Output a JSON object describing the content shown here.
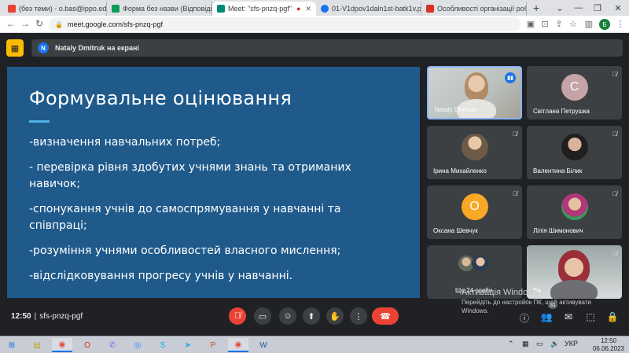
{
  "browser": {
    "tabs": [
      {
        "label": "(без теми) - o.bas@ippo.edu.",
        "icon": "gmail-icon",
        "color": "#ea4335"
      },
      {
        "label": "Форма без назви (Відповіді)",
        "icon": "sheets-icon",
        "color": "#0f9d58"
      },
      {
        "label": "Meet: \"sfs-pnzq-pgf\"",
        "icon": "meet-icon",
        "color": "#00897b",
        "active": true
      },
      {
        "label": "01-V1dpov1daln1st-batk1v.pd",
        "icon": "pdf-icon",
        "color": "#1a73e8"
      },
      {
        "label": "Особливості організації робо",
        "icon": "page-icon",
        "color": "#d93025"
      }
    ],
    "new_tab": "+",
    "url": "meet.google.com/sfs-pnzq-pgf",
    "profile_initial": "Б"
  },
  "meet": {
    "presenter_banner": "Nataly Dmitruk на екрані",
    "presenter_initial": "N",
    "slide": {
      "title": "Формувальне оцінювання",
      "bullets": [
        "-визначення навчальних потреб;",
        "- перевірка рівня здобутих учнями знань та отриманих навичок;",
        "-спонукання учнів до самоспрямування у навчанні та співпраці;",
        "-розуміння учнями особливостей власного мислення;",
        "-відслідковування прогресу учнів у навчанні."
      ]
    },
    "participants": [
      {
        "name": "Nataly Dmitruk",
        "speaking": true,
        "kind": "video"
      },
      {
        "name": "Світлана Петрушка",
        "initial": "С",
        "avatar_color": "#c5a3a6",
        "kind": "initial"
      },
      {
        "name": "Ірина Михайленко",
        "kind": "photo"
      },
      {
        "name": "Валентина Білик",
        "kind": "photo"
      },
      {
        "name": "Оксана Шевчук",
        "initial": "О",
        "avatar_color": "#f9a825",
        "kind": "initial"
      },
      {
        "name": "Лілія Шимонович",
        "kind": "photo"
      },
      {
        "name": "Ще 24 особи",
        "kind": "more"
      },
      {
        "name": "Ви",
        "kind": "video"
      }
    ],
    "meeting_time": "12:50",
    "meeting_code": "sfs-pnzq-pgf",
    "participant_count": "31"
  },
  "watermark": {
    "title": "Активація Windows",
    "subtitle": "Перейдіть до настройок ПК, щоб активувати Windows."
  },
  "taskbar": {
    "lang": "УКР",
    "time": "12:50",
    "date": "06.06.2023"
  }
}
